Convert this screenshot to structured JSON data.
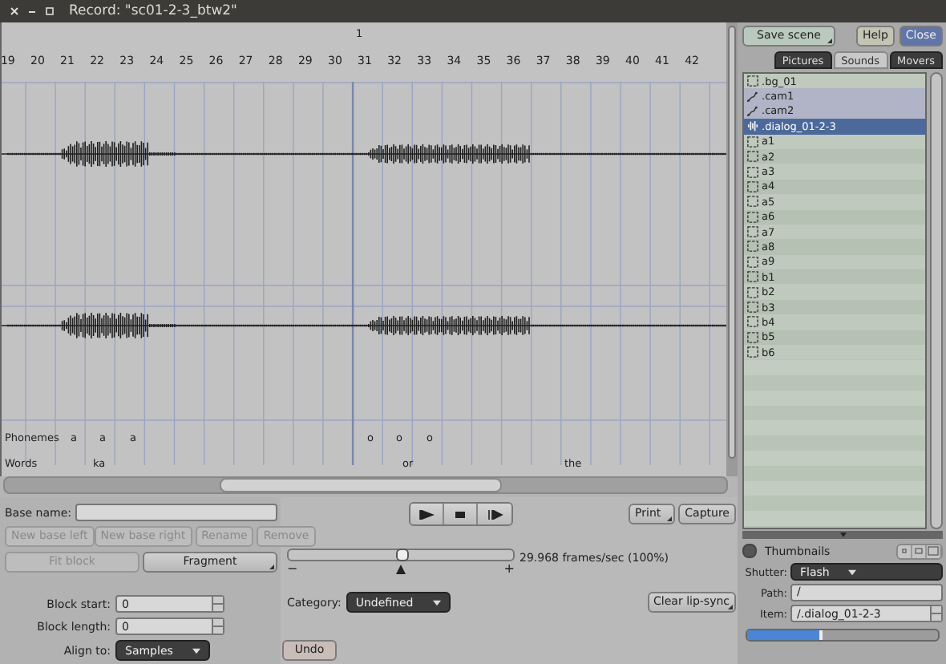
{
  "window": {
    "title": "Record: \"sc01-2-3_btw2\""
  },
  "ruler": {
    "ticks": [
      "19",
      "20",
      "21",
      "22",
      "23",
      "24",
      "25",
      "26",
      "27",
      "28",
      "29",
      "30",
      "31",
      "32",
      "33",
      "34",
      "35",
      "36",
      "37",
      "38",
      "39",
      "40",
      "41",
      "42"
    ],
    "marker": "1"
  },
  "tracks": {
    "phonemes_label": "Phonemes",
    "phonemes": [
      "a",
      "a",
      "a",
      "o",
      "o",
      "o"
    ],
    "words_label": "Words",
    "words": [
      "ka",
      "or",
      "the"
    ]
  },
  "base_name": {
    "label": "Base name:"
  },
  "base_buttons": [
    {
      "label": "New base left",
      "disabled": true
    },
    {
      "label": "New base right",
      "disabled": true
    },
    {
      "label": "Rename",
      "disabled": true
    },
    {
      "label": "Remove",
      "disabled": true
    }
  ],
  "fit_block": {
    "label": "Fit block",
    "disabled": true
  },
  "fragment": {
    "label": "Fragment",
    "disabled": false
  },
  "block_start": {
    "label": "Block start:",
    "value": "0"
  },
  "block_length": {
    "label": "Block length:",
    "value": "0"
  },
  "align_to": {
    "label": "Align to:",
    "value": "Samples"
  },
  "transport": [
    {
      "kind": "play"
    },
    {
      "kind": "stop"
    },
    {
      "kind": "step"
    }
  ],
  "print": "Print",
  "capture": "Capture",
  "speed": {
    "level": 0.5,
    "reading": "29.968 frames/sec (100%)",
    "minus": "−",
    "plus": "+"
  },
  "category": {
    "label": "Category:",
    "value": "Undefined"
  },
  "clear_lipsync": "Clear lip-sync",
  "undo": "Undo",
  "panel": {
    "save_scene": "Save scene",
    "help": "Help",
    "close": "Close",
    "tabs": [
      {
        "label": "Pictures",
        "selected": false
      },
      {
        "label": "Sounds",
        "selected": true
      },
      {
        "label": "Movers",
        "selected": false
      }
    ],
    "items": [
      {
        "name": ".bg_01",
        "kind": "frame",
        "selected": false
      },
      {
        "name": ".cam1",
        "kind": "camera",
        "selected": false
      },
      {
        "name": ".cam2",
        "kind": "camera",
        "selected": false
      },
      {
        "name": ".dialog_01-2-3",
        "kind": "sound",
        "selected": true
      },
      {
        "name": "a1",
        "kind": "frame",
        "selected": false
      },
      {
        "name": "a2",
        "kind": "frame",
        "selected": false
      },
      {
        "name": "a3",
        "kind": "frame",
        "selected": false
      },
      {
        "name": "a4",
        "kind": "frame",
        "selected": false
      },
      {
        "name": "a5",
        "kind": "frame",
        "selected": false
      },
      {
        "name": "a6",
        "kind": "frame",
        "selected": false
      },
      {
        "name": "a7",
        "kind": "frame",
        "selected": false
      },
      {
        "name": "a8",
        "kind": "frame",
        "selected": false
      },
      {
        "name": "a9",
        "kind": "frame",
        "selected": false
      },
      {
        "name": "b1",
        "kind": "frame",
        "selected": false
      },
      {
        "name": "b2",
        "kind": "frame",
        "selected": false
      },
      {
        "name": "b3",
        "kind": "frame",
        "selected": false
      },
      {
        "name": "b4",
        "kind": "frame",
        "selected": false
      },
      {
        "name": "b5",
        "kind": "frame",
        "selected": false
      },
      {
        "name": "b6",
        "kind": "frame",
        "selected": false
      }
    ],
    "thumbnails": {
      "label": "Thumbnails",
      "on": false
    },
    "shutter": {
      "label": "Shutter:",
      "value": "Flash"
    },
    "path": {
      "label": "Path:",
      "value": "/"
    },
    "item": {
      "label": "Item:",
      "value": "/.dialog_01-2-3"
    },
    "zoom": {
      "level": 0.38
    }
  }
}
